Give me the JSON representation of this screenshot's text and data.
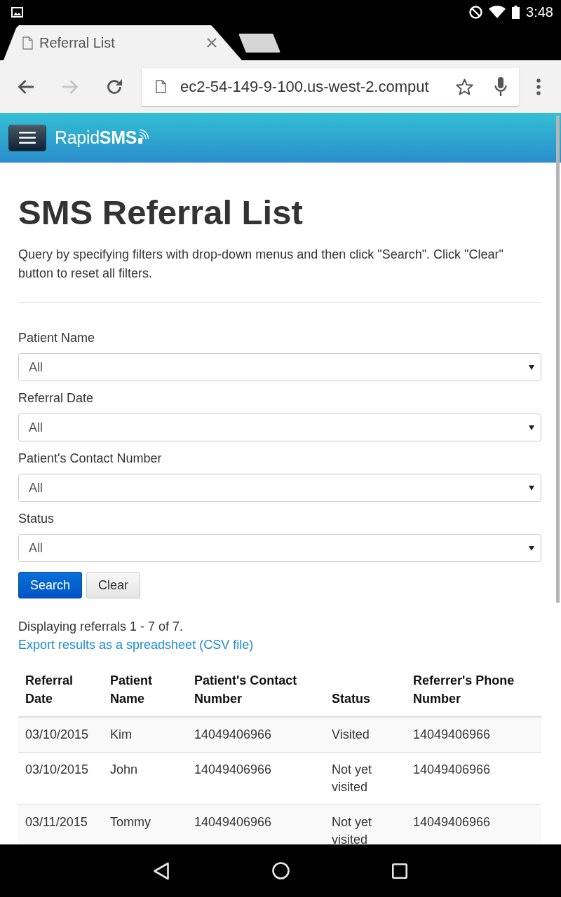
{
  "status_bar": {
    "time": "3:48"
  },
  "browser": {
    "tabs": [
      {
        "title": "Referral List",
        "selected": true
      }
    ],
    "nav_buttons": [
      {
        "kind": "back",
        "disabled": false
      },
      {
        "kind": "forward",
        "disabled": true
      },
      {
        "kind": "reload",
        "disabled": false
      }
    ],
    "url": "ec2-54-149-9-100.us-west-2.comput"
  },
  "navbar": {
    "brand": "Rapid**SMS**"
  },
  "page": {
    "title": "SMS Referral List",
    "intro": "Query by specifying filters with drop-down menus and then click \"Search\". Click \"Clear\" button to reset all filters.",
    "filters": [
      {
        "label": "Patient Name",
        "value": "All"
      },
      {
        "label": "Referral Date",
        "value": "All"
      },
      {
        "label": "Patient's Contact Number",
        "value": "All"
      },
      {
        "label": "Status",
        "value": "All"
      }
    ],
    "buttons": [
      {
        "label": "Search",
        "kind": "primary"
      },
      {
        "label": "Clear",
        "kind": "default"
      }
    ],
    "summary": "Displaying referrals 1 - 7 of 7.",
    "export_link": "Export results as a spreadsheet (CSV file)"
  },
  "table": {
    "columns": [
      "Referral Date",
      "Patient Name",
      "Patient's Contact Number",
      "Status",
      "Referrer's Phone Number"
    ],
    "rows": [
      [
        "03/10/2015",
        "Kim",
        "14049406966",
        "Visited",
        "14049406966"
      ],
      [
        "03/10/2015",
        "John",
        "14049406966",
        "Not yet visited",
        "14049406966"
      ],
      [
        "03/11/2015",
        "Tommy",
        "14049406966",
        "Not yet visited",
        "14049406966"
      ]
    ]
  }
}
